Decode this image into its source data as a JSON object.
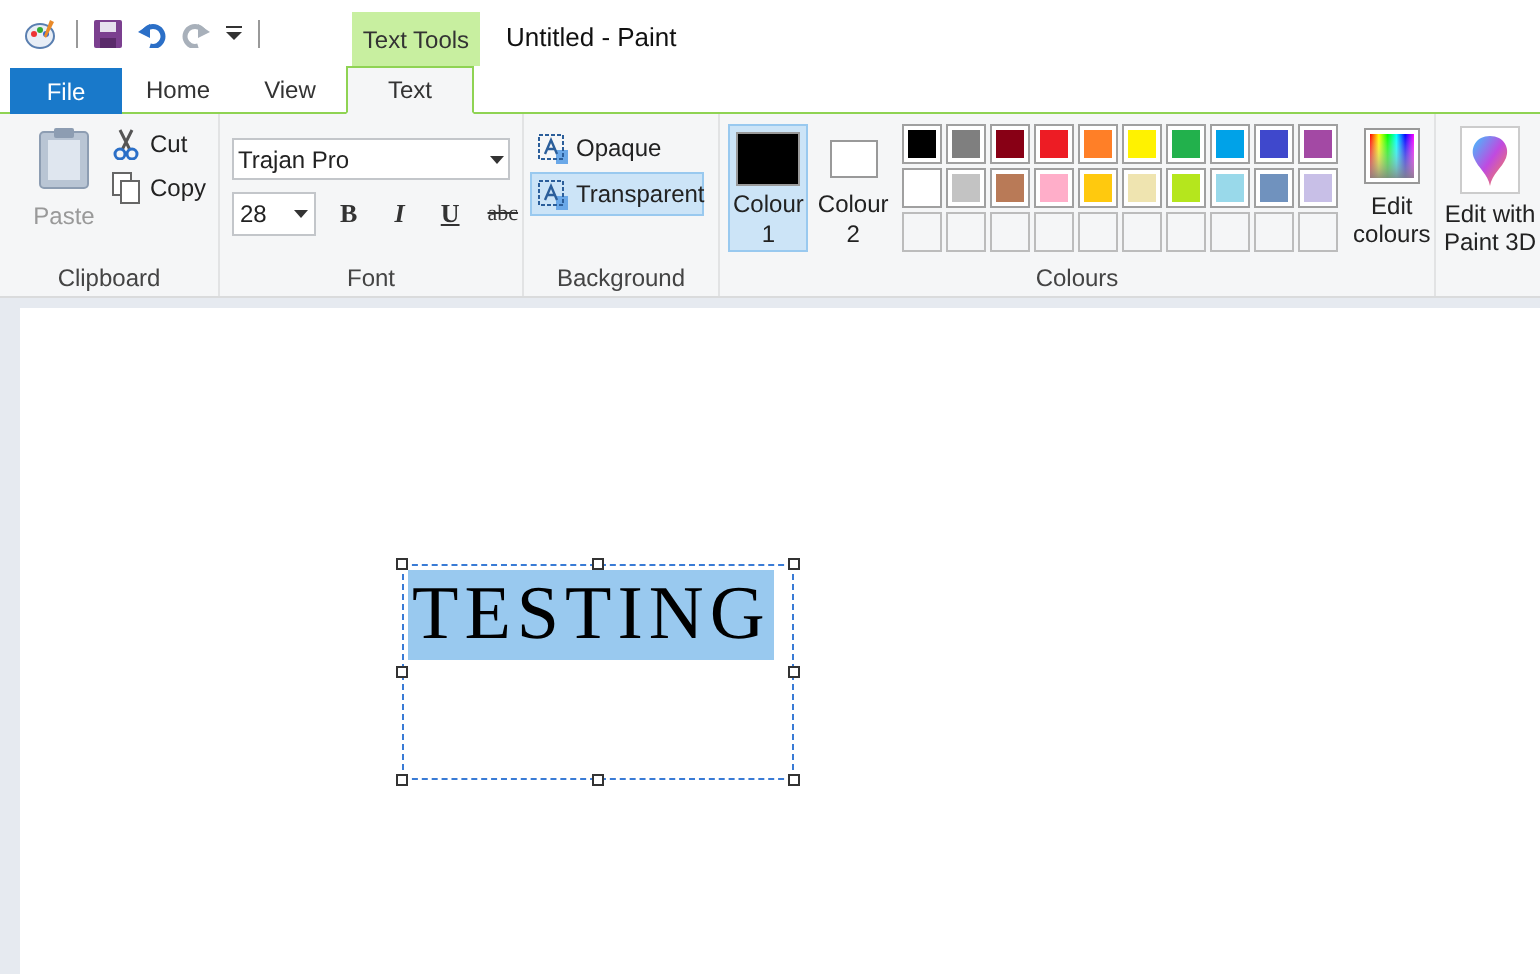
{
  "window": {
    "title": "Untitled - Paint"
  },
  "contextual_tab": "Text Tools",
  "tabs": [
    {
      "label": "File",
      "kind": "file",
      "selected": false
    },
    {
      "label": "Home",
      "kind": "tab",
      "selected": false
    },
    {
      "label": "View",
      "kind": "tab",
      "selected": false
    },
    {
      "label": "Text",
      "kind": "tab",
      "selected": true
    }
  ],
  "clipboard": {
    "paste": "Paste",
    "disabled": true,
    "cut": "Cut",
    "copy": "Copy",
    "label": "Clipboard"
  },
  "font": {
    "family": "Trajan Pro",
    "size": "28",
    "bold": "B",
    "italic": "I",
    "underline": "U",
    "strikethrough": "abc",
    "label": "Font"
  },
  "background": {
    "options": [
      {
        "label": "Opaque",
        "selected": false
      },
      {
        "label": "Transparent",
        "selected": true
      }
    ],
    "label": "Background"
  },
  "colours": {
    "current": [
      {
        "label": "Colour\n1",
        "color": "#000000",
        "selected": true
      },
      {
        "label": "Colour\n2",
        "color": "#ffffff",
        "selected": false
      }
    ],
    "palette": [
      [
        {
          "color": "#000000"
        },
        {
          "color": "#7f7f7f"
        },
        {
          "color": "#880015"
        },
        {
          "color": "#ed1c24"
        },
        {
          "color": "#ff7f27"
        },
        {
          "color": "#fff200"
        },
        {
          "color": "#22b14c"
        },
        {
          "color": "#00a2e8"
        },
        {
          "color": "#3f48cc"
        },
        {
          "color": "#a349a4"
        }
      ],
      [
        {
          "color": "#ffffff"
        },
        {
          "color": "#c3c3c3"
        },
        {
          "color": "#b97a57"
        },
        {
          "color": "#ffaec9"
        },
        {
          "color": "#ffc90e"
        },
        {
          "color": "#efe4b0"
        },
        {
          "color": "#b5e61d"
        },
        {
          "color": "#99d9ea"
        },
        {
          "color": "#7092be"
        },
        {
          "color": "#c8bfe7"
        }
      ],
      [
        {
          "kind": "empty"
        },
        {
          "kind": "empty"
        },
        {
          "kind": "empty"
        },
        {
          "kind": "empty"
        },
        {
          "kind": "empty"
        },
        {
          "kind": "empty"
        },
        {
          "kind": "empty"
        },
        {
          "kind": "empty"
        },
        {
          "kind": "empty"
        },
        {
          "kind": "empty"
        }
      ]
    ],
    "edit": "Edit\ncolours",
    "label": "Colours"
  },
  "paint3d": "Edit with\nPaint 3D",
  "canvas": {
    "text": "TESTING"
  }
}
